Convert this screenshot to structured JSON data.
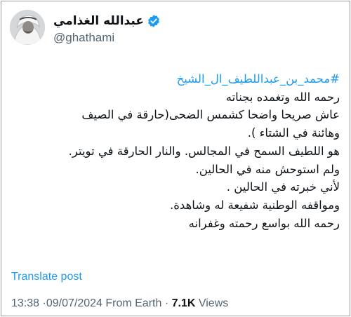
{
  "author": {
    "display_name": "عبدالله الغذامي",
    "handle": "@ghathami",
    "verified": true,
    "verified_color": "#1d9bf0"
  },
  "tweet": {
    "hashtag": "#محمد_بن_عبداللطيف_ال_الشيخ",
    "lines": [
      "رحمه الله وتغمده بجناته",
      "عاش صريحا واضحا كشمس الضحى(حارقة في الصيف",
      "وهائنة في الشتاء ).",
      "هو اللطيف السمح في المجالس. والنار الحارقة في تويتر.",
      "ولم استوحش منه في الحالين.",
      "لأني خبرته في الحالين .",
      "ومواقفه الوطنية شفيعة له وشاهدة.",
      "رحمه الله بواسع رحمته وغفرانه"
    ]
  },
  "translate_label": "Translate post",
  "meta": {
    "time": "13:38",
    "date": "09/07/2024",
    "source": "From Earth",
    "separator": "·",
    "views_count": "7.1K",
    "views_label": "Views"
  },
  "colors": {
    "link": "#1d9bf0",
    "secondary_text": "#536471",
    "primary_text": "#0f1419"
  },
  "icons": {
    "verified": "verified-badge-icon",
    "avatar": "avatar-photo"
  }
}
